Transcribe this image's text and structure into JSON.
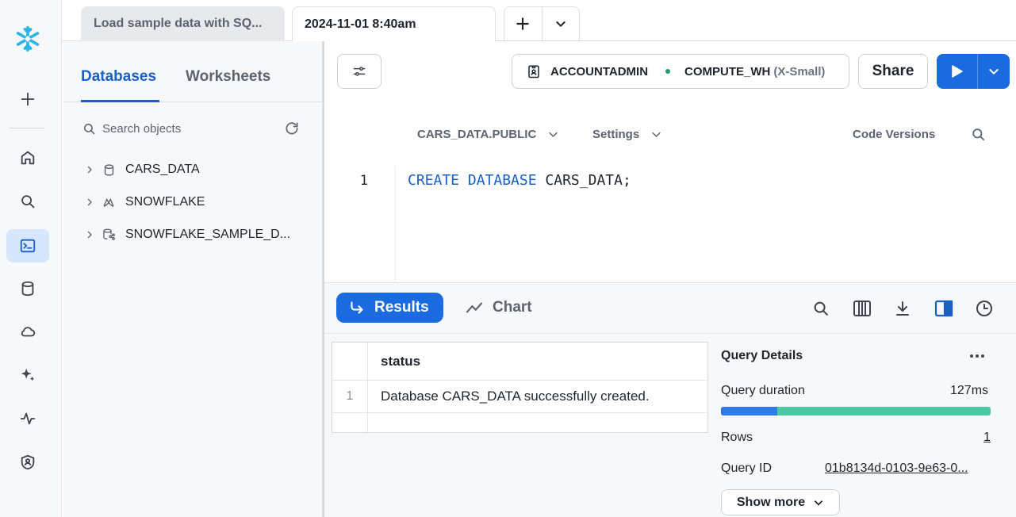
{
  "tabs": [
    {
      "label": "Load sample data with SQ..."
    },
    {
      "label": "2024-11-01 8:40am"
    }
  ],
  "browser": {
    "tabs": [
      "Databases",
      "Worksheets"
    ],
    "search_placeholder": "Search objects",
    "items": [
      {
        "label": "CARS_DATA",
        "icon": "database-icon"
      },
      {
        "label": "SNOWFLAKE",
        "icon": "snowflake-share-icon"
      },
      {
        "label": "SNOWFLAKE_SAMPLE_D...",
        "icon": "shared-database-icon"
      }
    ]
  },
  "toolbar": {
    "role": "ACCOUNTADMIN",
    "warehouse": "COMPUTE_WH",
    "warehouse_size": "(X-Small)",
    "share_label": "Share"
  },
  "editor": {
    "context": "CARS_DATA.PUBLIC",
    "settings_label": "Settings",
    "code_versions_label": "Code Versions",
    "line_number": "1",
    "code_kw1": "CREATE",
    "code_kw2": "DATABASE",
    "code_rest": "CARS_DATA;"
  },
  "results": {
    "results_label": "Results",
    "chart_label": "Chart",
    "column": "status",
    "rows": [
      {
        "index": "1",
        "status": "Database CARS_DATA successfully created."
      }
    ]
  },
  "query_details": {
    "title": "Query Details",
    "duration_label": "Query duration",
    "duration_value": "127ms",
    "duration_exec_fraction": 0.21,
    "rows_label": "Rows",
    "rows_value": "1",
    "query_id_label": "Query ID",
    "query_id_value": "01b8134d-0103-9e63-0...",
    "show_more_label": "Show more"
  },
  "colors": {
    "brand": "#29b5e8",
    "accent": "#1a6be0",
    "active_tab": "#1a5fc4",
    "status_dot": "#1f9d6b"
  }
}
